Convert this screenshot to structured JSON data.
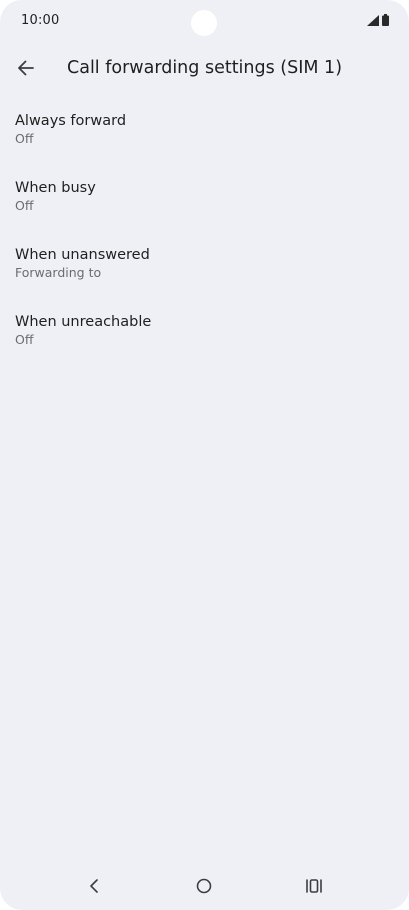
{
  "status_bar": {
    "time": "10:00",
    "icons": [
      "signal-icon",
      "battery-icon"
    ]
  },
  "app_bar": {
    "back_icon": "arrow-left-icon",
    "title": "Call forwarding settings (SIM 1)"
  },
  "settings": [
    {
      "title": "Always forward",
      "summary": "Off"
    },
    {
      "title": "When busy",
      "summary": "Off"
    },
    {
      "title": "When unanswered",
      "summary": "Forwarding to"
    },
    {
      "title": "When unreachable",
      "summary": "Off"
    }
  ],
  "nav_bar": {
    "icons": [
      "nav-back-icon",
      "nav-home-icon",
      "nav-recents-icon"
    ]
  },
  "colors": {
    "background": "#eff0f6",
    "text_primary": "#1f1f1f",
    "text_secondary": "#6b6b70"
  }
}
